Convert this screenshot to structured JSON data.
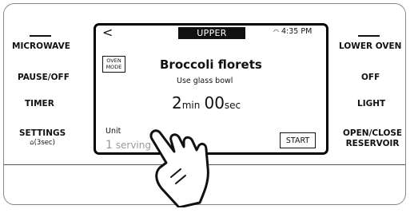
{
  "left_buttons": {
    "microwave": "MICROWAVE",
    "pause_off": "PAUSE/OFF",
    "timer": "TIMER",
    "settings": "SETTINGS",
    "settings_hint": "⌂(3sec)"
  },
  "right_buttons": {
    "lower_oven": "LOWER OVEN",
    "off": "OFF",
    "light": "LIGHT",
    "open_close_line1": "OPEN/CLOSE",
    "open_close_line2": "RESERVOIR"
  },
  "screen": {
    "back_glyph": "<",
    "tab_label": "UPPER",
    "wifi_icon": "◠",
    "time": "4:35 PM",
    "oven_mode_line1": "OVEN",
    "oven_mode_line2": "MODE",
    "food_title": "Broccoli florets",
    "food_note": "Use glass bowl",
    "timer_minutes": "2",
    "timer_min_unit": "min",
    "timer_seconds": "00",
    "timer_sec_unit": "sec",
    "unit_label": "Unit",
    "unit_count": "1",
    "unit_word": "serving",
    "start_label": "START"
  }
}
